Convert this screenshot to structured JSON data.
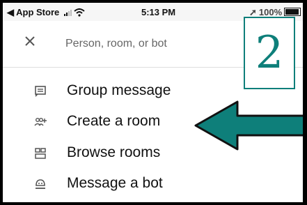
{
  "status_bar": {
    "back_app": "◀ App Store",
    "time": "5:13 PM",
    "battery": "100%"
  },
  "search": {
    "placeholder": "Person, room, or bot"
  },
  "menu": {
    "items": [
      {
        "label": "Group message",
        "icon": "chat-icon"
      },
      {
        "label": "Create a room",
        "icon": "add-people-icon"
      },
      {
        "label": "Browse rooms",
        "icon": "grid-icon"
      },
      {
        "label": "Message a bot",
        "icon": "bot-icon"
      }
    ]
  },
  "annotation": {
    "step_number": "2",
    "color": "#0e7f7a"
  }
}
